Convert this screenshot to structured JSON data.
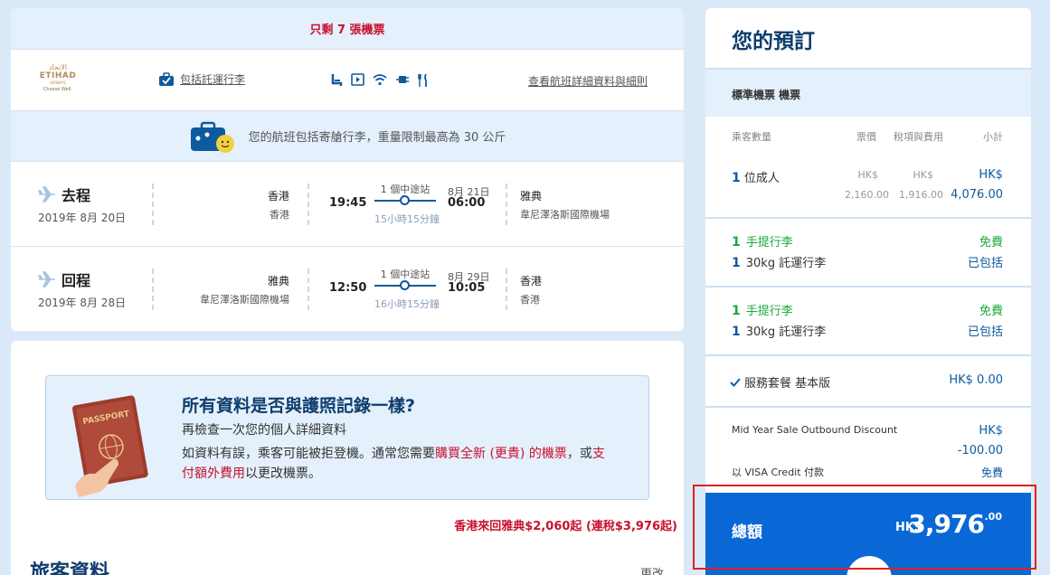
{
  "flight": {
    "seats_left": "只剩 7 張機票",
    "airline_logo": {
      "arabic": "الاتحاد",
      "name": "ETIHAD",
      "sub": "AIRWAYS",
      "tagline": "Choose Well."
    },
    "baggage_link": "包括託運行李",
    "amenity_icons": [
      "seat-icon",
      "entertainment-icon",
      "wifi-icon",
      "power-icon",
      "meal-icon"
    ],
    "details_link": "查看航班詳細資料與細則",
    "baggage_notice": "您的航班包括寄艙行李，重量限制最高為 30 公斤",
    "legs": [
      {
        "direction": "去程",
        "date": "2019年 8月 20日",
        "from_city": "香港",
        "from_airport": "香港",
        "dep_time": "19:45",
        "stops": "1 個中途站",
        "duration": "15小時15分鐘",
        "arr_date": "8月 21日",
        "arr_time": "06:00",
        "to_city": "雅典",
        "to_airport": "韋尼澤洛斯國際機場"
      },
      {
        "direction": "回程",
        "date": "2019年 8月 28日",
        "from_city": "雅典",
        "from_airport": "韋尼澤洛斯國際機場",
        "dep_time": "12:50",
        "stops": "1 個中途站",
        "duration": "16小時15分鐘",
        "arr_date": "8月 29日",
        "arr_time": "10:05",
        "to_city": "香港",
        "to_airport": "香港"
      }
    ]
  },
  "passport": {
    "passport_label": "PASSPORT",
    "title": "所有資料是否與護照記錄一樣?",
    "subtitle": "再檢查一次您的個人詳細資料",
    "body_1": "如資料有誤，乘客可能被拒登機。通常您需要",
    "body_red_1": "購買全新 (更貴) 的機票",
    "body_2": "，或",
    "body_red_2": "支付額外費用",
    "body_3": "以更改機票。"
  },
  "promo": "香港來回雅典$2,060起 (連稅$3,976起)",
  "travellers": {
    "title": "旅客資料",
    "edit": "更改"
  },
  "booking": {
    "title": "您的預訂",
    "fare_type": "標準機票 機票",
    "headers": {
      "pax": "乘客數量",
      "fare": "票價",
      "tax": "稅項與費用",
      "subtotal": "小計"
    },
    "pax_count": "1",
    "pax_label": "位成人",
    "fare_cur": "HK$",
    "fare_val": "2,160.00",
    "tax_cur": "HK$",
    "tax_val": "1,916.00",
    "subtotal_cur": "HK$",
    "subtotal_val": "4,076.00",
    "bags": [
      {
        "hand_count": "1",
        "hand_label": "手提行李",
        "hand_status": "免費",
        "checked_count": "1",
        "checked_label": "30kg 託運行李",
        "checked_status": "已包括"
      },
      {
        "hand_count": "1",
        "hand_label": "手提行李",
        "hand_status": "免費",
        "checked_count": "1",
        "checked_label": "30kg 託運行李",
        "checked_status": "已包括"
      }
    ],
    "service_label": "服務套餐 基本版",
    "service_price": "HK$ 0.00",
    "discount_label": "Mid Year Sale Outbound Discount",
    "discount_cur": "HK$",
    "discount_val": "-100.00",
    "payment_label": "以 VISA Credit 付款",
    "payment_val": "免費",
    "total_label": "總額",
    "total_cur": "HK$",
    "total_amount": "3,976",
    "total_decimals": ".00"
  },
  "colors": {
    "primary": "#0e5a9e",
    "accent_red": "#c8102e",
    "success_green": "#1aa83a",
    "total_blue": "#0a68d6"
  }
}
